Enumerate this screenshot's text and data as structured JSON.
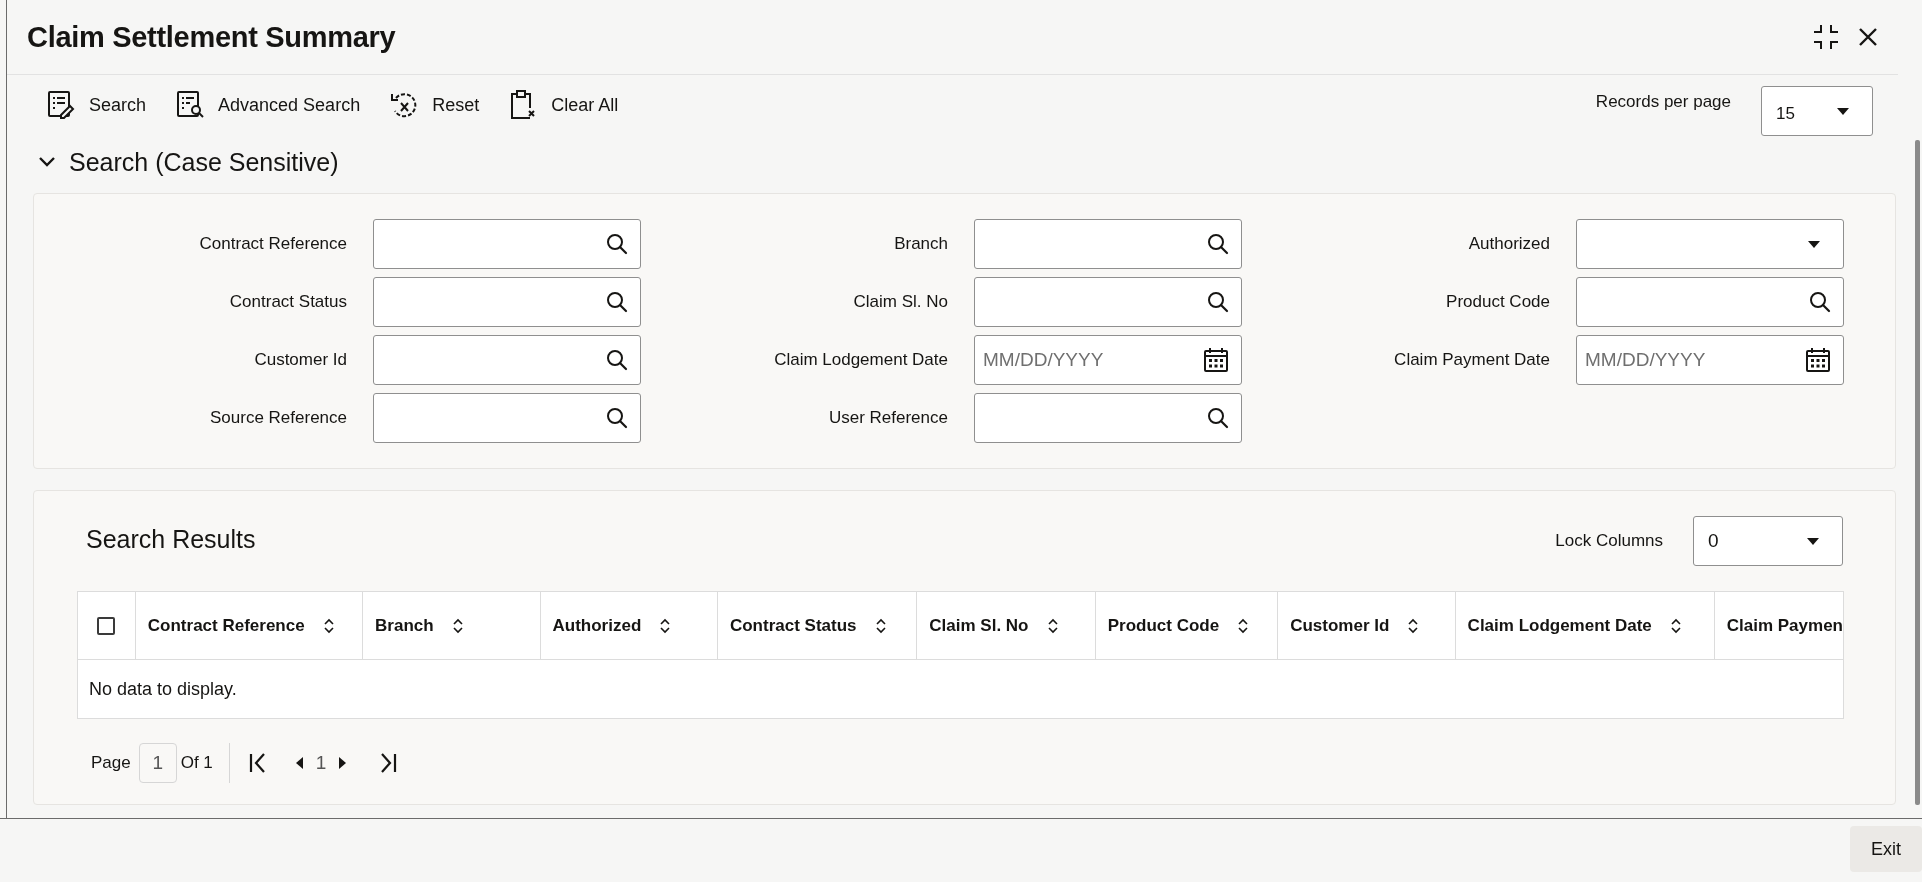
{
  "window": {
    "title": "Claim Settlement Summary"
  },
  "toolbar": [
    {
      "kind": "search",
      "label": "Search"
    },
    {
      "kind": "advanced",
      "label": "Advanced Search"
    },
    {
      "kind": "reset",
      "label": "Reset"
    },
    {
      "kind": "clear",
      "label": "Clear All"
    }
  ],
  "records_per_page": {
    "label": "Records per page",
    "value": "15"
  },
  "search_section": {
    "title": "Search (Case Sensitive)",
    "expanded": true,
    "fields": [
      {
        "label": "Contract Reference",
        "kind": "lookup"
      },
      {
        "label": "Branch",
        "kind": "lookup"
      },
      {
        "label": "Authorized",
        "kind": "select"
      },
      {
        "label": "Contract Status",
        "kind": "lookup"
      },
      {
        "label": "Claim Sl. No",
        "kind": "lookup"
      },
      {
        "label": "Product Code",
        "kind": "lookup"
      },
      {
        "label": "Customer Id",
        "kind": "lookup"
      },
      {
        "label": "Claim Lodgement Date",
        "kind": "date",
        "placeholder": "MM/DD/YYYY"
      },
      {
        "label": "Claim Payment Date",
        "kind": "date",
        "placeholder": "MM/DD/YYYY"
      },
      {
        "label": "Source Reference",
        "kind": "lookup"
      },
      {
        "label": "User Reference",
        "kind": "lookup"
      }
    ]
  },
  "search_results": {
    "title": "Search Results",
    "lock_columns": {
      "label": "Lock Columns",
      "value": "0"
    },
    "select_all_checked": false,
    "columns": [
      "Contract Reference",
      "Branch",
      "Authorized",
      "Contract Status",
      "Claim Sl. No",
      "Product Code",
      "Customer Id",
      "Claim Lodgement Date",
      "Claim Paymen"
    ],
    "empty_message": "No data to display.",
    "pagination": {
      "page_label": "Page",
      "page": "1",
      "of_label": "Of 1",
      "current": "1"
    }
  },
  "footer": {
    "exit_label": "Exit"
  }
}
